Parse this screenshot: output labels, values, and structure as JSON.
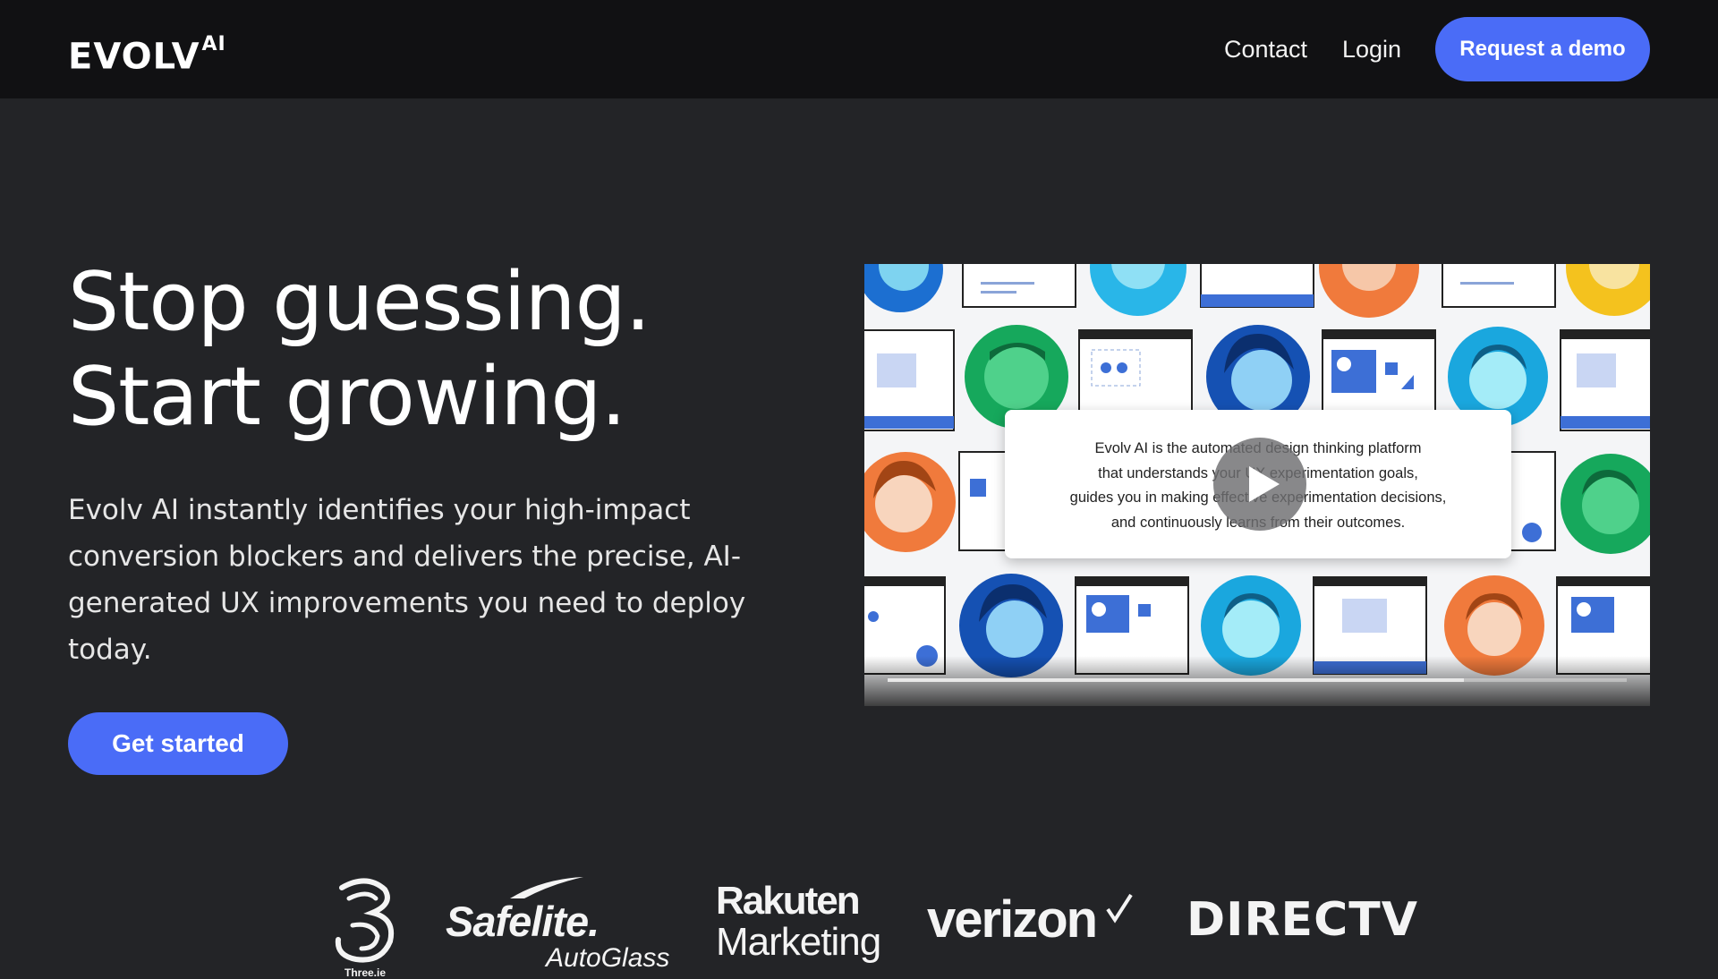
{
  "header": {
    "logo": "EVOLV",
    "logo_suffix": "AI",
    "nav": {
      "contact": "Contact",
      "login": "Login"
    },
    "demo_button": "Request a demo"
  },
  "hero": {
    "headline_line1": "Stop guessing.",
    "headline_line2": "Start growing.",
    "subtext": "Evolv AI instantly identifies your high-impact conversion blockers and delivers the precise, AI-generated UX improvements you need to deploy today.",
    "cta": "Get started"
  },
  "video": {
    "caption_lines": [
      "Evolv AI is the automated design thinking platform",
      "that understands your UX experimentation goals,",
      "guides you in making effective experimentation decisions,",
      "and continuously learns from their outcomes."
    ],
    "progress": 0.78,
    "play_icon": "play-icon"
  },
  "logos": {
    "three_small": "Three.ie",
    "safelite": "Safelite.",
    "safelite_sub": "AutoGlass",
    "rakuten": "Rakuten",
    "rakuten_sub": "Marketing",
    "verizon": "verizon",
    "directv": "DIRECTV"
  },
  "colors": {
    "header_bg": "#111113",
    "page_bg": "#232427",
    "accent": "#4a6cf7"
  }
}
